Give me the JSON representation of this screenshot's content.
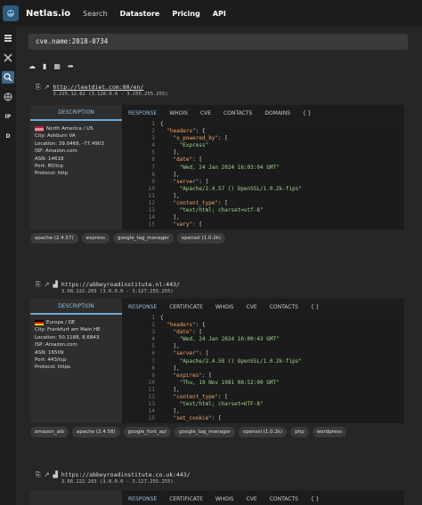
{
  "topbar": {
    "brand": "Netlas.io",
    "nav": [
      "Search",
      "Datastore",
      "Pricing",
      "API"
    ]
  },
  "sidebar": {
    "items": [
      "responses-icon",
      "tools-icon",
      "search-icon",
      "globe-icon",
      "IP",
      "D"
    ]
  },
  "search": {
    "value": "cve.name:2018-0734"
  },
  "toolbar": {
    "icons": [
      "cloud-download-icon",
      "chart-icon",
      "table-icon",
      "share-icon"
    ]
  },
  "results": [
    {
      "url": "http://leetdiet.com:80/en/",
      "ip_range": "3.225.12.82 (3.128.0.0 - 3.255.255.255)",
      "tabs": [
        "RESPONSE",
        "WHOIS",
        "CVE",
        "CONTACTS",
        "DOMAINS",
        "{ }"
      ],
      "description_label": "DESCRIPTION",
      "info": {
        "region": "North America / US",
        "city": "City: Ashburn VA",
        "location": "Location: 39.0469, -77.4903",
        "isp": "ISP: Amazon.com",
        "asn": "ASN: 14618",
        "port": "Port: 80/tcp",
        "protocol": "Protocol: http"
      },
      "code": [
        "{",
        "  \"headers\": {",
        "    \"x_powered_by\": [",
        "      \"Express\"",
        "    ],",
        "    \"date\": [",
        "      \"Wed, 24 Jan 2024 16:03:04 GMT\"",
        "    ],",
        "    \"server\": [",
        "      \"Apache/2.4.57 () OpenSSL/1.0.2k-fips\"",
        "    ],",
        "    \"content_type\": [",
        "      \"text/html; charset=utf-8\"",
        "    ],",
        "    \"vary\": ["
      ],
      "tags": [
        "apache (2.4.57)",
        "express",
        "google_tag_manager",
        "openssl (1.0.2k)"
      ]
    },
    {
      "url": "https://abbeyroadinstitute.nl:443/",
      "ip_range": "3.68.122.203 (3.0.0.0 - 3.127.255.255)",
      "tabs": [
        "RESPONSE",
        "CERTIFICATE",
        "WHOIS",
        "CVE",
        "CONTACTS",
        "{ }"
      ],
      "description_label": "DESCRIPTION",
      "info": {
        "region": "Europe / DE",
        "city": "City: Frankfurt am Main HE",
        "location": "Location: 50.1188, 8.6843",
        "isp": "ISP: Amazon.com",
        "asn": "ASN: 16509",
        "port": "Port: 443/tcp",
        "protocol": "Protocol: https"
      },
      "code": [
        "{",
        "  \"headers\": {",
        "    \"date\": [",
        "      \"Wed, 24 Jan 2024 16:00:43 GMT\"",
        "    ],",
        "    \"server\": [",
        "      \"Apache/2.4.58 () OpenSSL/1.0.2k-fips\"",
        "    ],",
        "    \"expires\": [",
        "      \"Thu, 19 Nov 1981 08:52:00 GMT\"",
        "    ],",
        "    \"content_type\": [",
        "      \"text/html; charset=UTF-8\"",
        "    ],",
        "    \"set_cookie\": ["
      ],
      "tags": [
        "amazon_alb",
        "apache (2.4.58)",
        "google_font_api",
        "google_tag_manager",
        "openssl (1.0.2k)",
        "php",
        "wordpress"
      ]
    },
    {
      "url": "https://abbeyroadinstitute.co.uk:443/",
      "ip_range": "3.68.122.203 (3.0.0.0 - 3.127.255.255)",
      "tabs": [
        "RESPONSE",
        "CERTIFICATE",
        "WHOIS",
        "CVE",
        "CONTACTS",
        "{ }"
      ]
    }
  ]
}
